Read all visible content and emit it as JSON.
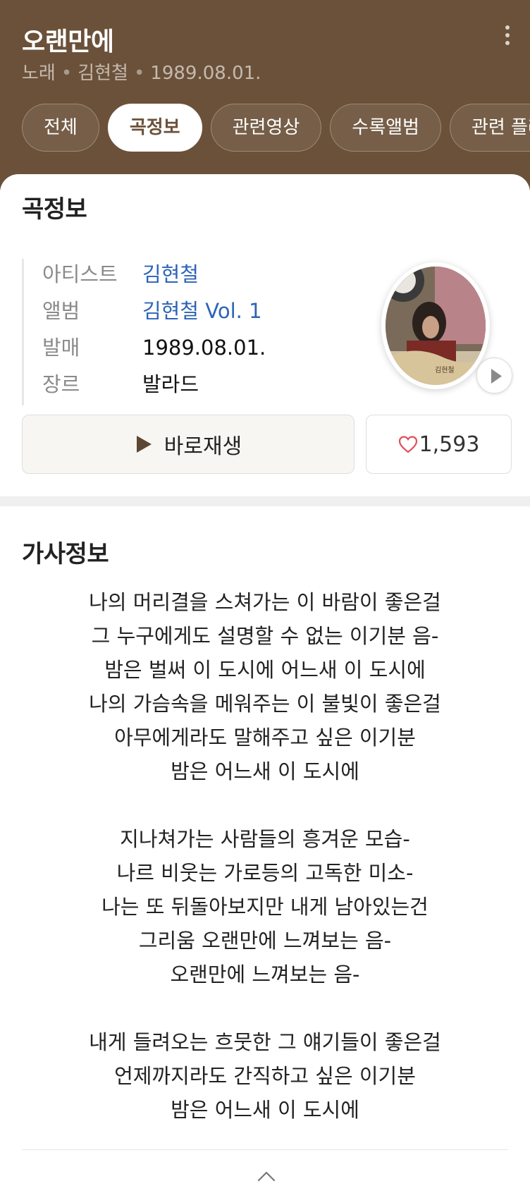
{
  "header": {
    "title": "오랜만에",
    "meta": [
      "노래",
      "김현철",
      "1989.08.01."
    ],
    "separator": "•",
    "bg_color": "#6b5139",
    "more_icon": "more-vertical-icon"
  },
  "tabs": [
    {
      "label": "전체",
      "active": false
    },
    {
      "label": "곡정보",
      "active": true
    },
    {
      "label": "관련영상",
      "active": false
    },
    {
      "label": "수록앨범",
      "active": false
    },
    {
      "label": "관련 플레이리스트",
      "active": false
    }
  ],
  "song_info": {
    "title": "곡정보",
    "rows": [
      {
        "key": "아티스트",
        "value": "김현철"
      },
      {
        "key": "앨범",
        "value": "김현철 Vol. 1"
      },
      {
        "key": "발매",
        "value": "1989.08.01."
      },
      {
        "key": "장르",
        "value": "발라드"
      }
    ],
    "album_art_icon": "album-cover-image",
    "play_button": {
      "icon": "play-icon",
      "label": "바로재생"
    },
    "like_button": {
      "icon": "heart-icon",
      "count": "1,593",
      "color": "#e0505a"
    },
    "link_color": "#2d63b8"
  },
  "lyrics": {
    "title": "가사정보",
    "lines": [
      "나의 머리결을 스쳐가는 이 바람이 좋은걸",
      "그 누구에게도 설명할 수 없는 이기분 음-",
      "밤은 벌써 이 도시에 어느새 이 도시에",
      "나의 가슴속을 메워주는 이 불빛이 좋은걸",
      "아무에게라도 말해주고 싶은 이기분",
      "밤은 어느새 이 도시에",
      "",
      "지나쳐가는 사람들의 흥겨운 모습-",
      "나르 비웃는 가로등의 고독한 미소-",
      "나는 또 뒤돌아보지만 내게 남아있는건",
      "그리움 오랜만에 느껴보는 음-",
      "오랜만에 느껴보는 음-",
      "",
      "내게 들려오는 흐뭇한 그 얘기들이 좋은걸",
      "언제까지라도 간직하고 싶은 이기분",
      "밤은 어느새 이 도시에"
    ],
    "collapse_icon": "chevron-up-icon"
  }
}
